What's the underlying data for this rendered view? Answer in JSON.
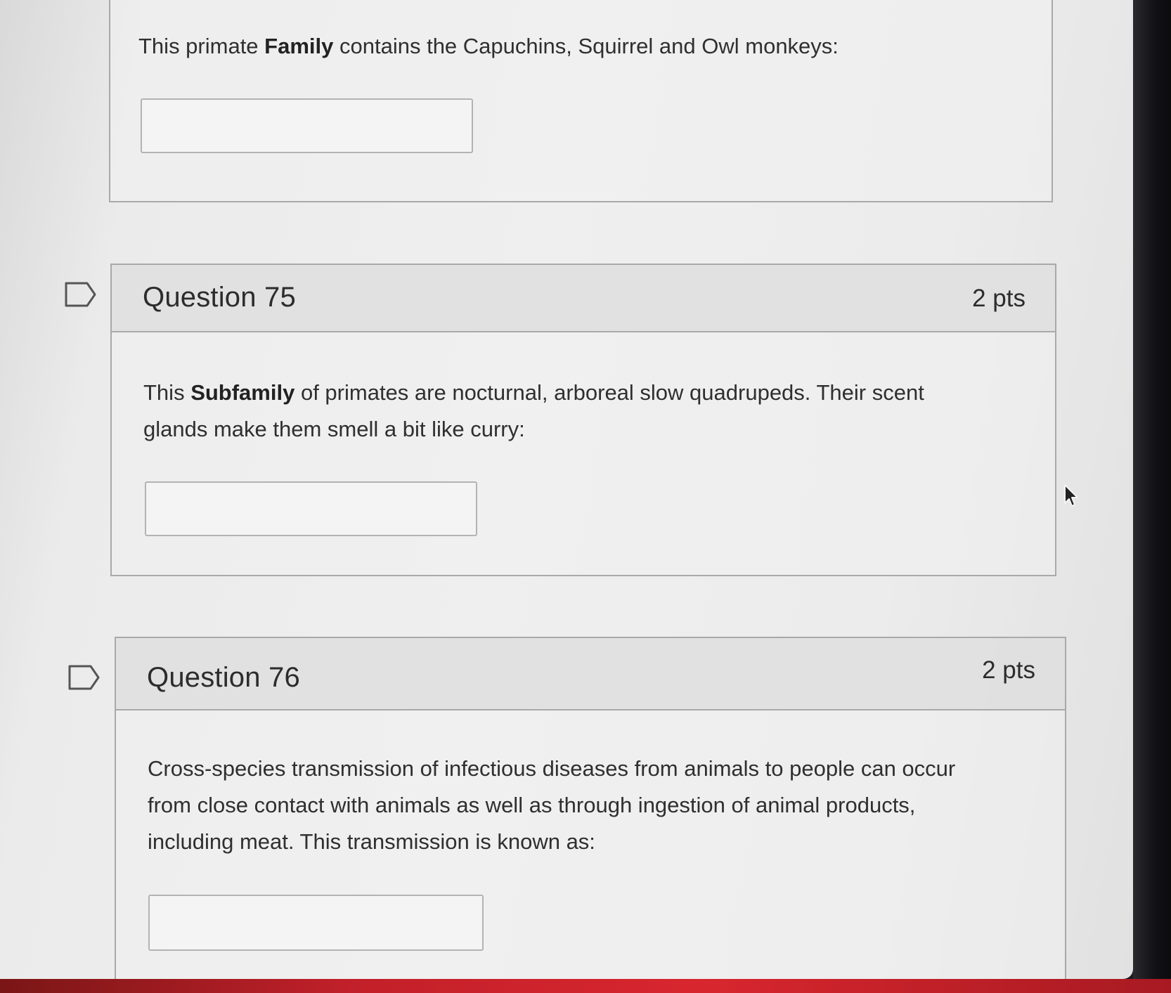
{
  "questions": [
    {
      "prefix": "This primate ",
      "bold": "Family",
      "suffix": " contains the Capuchins, Squirrel and Owl monkeys:",
      "answer_value": ""
    },
    {
      "title": "Question 75",
      "points": "2 pts",
      "prefix": "This ",
      "bold": "Subfamily",
      "suffix_line1": " of primates are nocturnal, arboreal slow quadrupeds. Their scent",
      "line2": "glands make them smell a bit like curry:",
      "answer_value": ""
    },
    {
      "title": "Question 76",
      "points": "2 pts",
      "line1": "Cross-species transmission of infectious diseases from animals to people can occur",
      "line2": "from close contact with animals as well as through ingestion of animal products,",
      "line3": "including meat. This transmission is known as:",
      "answer_value": ""
    }
  ],
  "icons": {
    "flag": "flag-outline-icon",
    "cursor": "mouse-pointer-icon"
  },
  "colors": {
    "border": "#a9a9a9",
    "text": "#2c2c2c"
  }
}
